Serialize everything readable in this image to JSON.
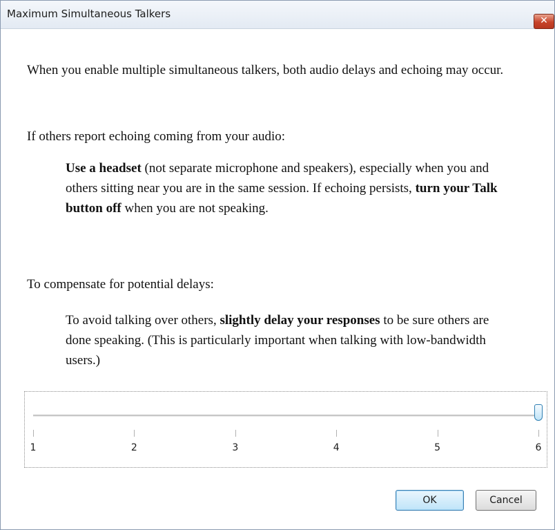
{
  "window": {
    "title": "Maximum Simultaneous Talkers",
    "close_glyph": "✕"
  },
  "body": {
    "intro": "When you enable multiple simultaneous talkers, both audio delays and echoing may occur.",
    "echo_heading": "If others report echoing coming from your audio:",
    "echo_advice": {
      "bold1": "Use a headset",
      "text1": " (not separate microphone and speakers), especially when you and others sitting near you are in the same session. If echoing persists, ",
      "bold2": "turn your Talk button off",
      "text2": " when you are not speaking."
    },
    "delay_heading": "To compensate for potential delays:",
    "delay_advice": {
      "text1": "To avoid talking over others, ",
      "bold1": "slightly delay your responses",
      "text2": " to be sure others are done speaking. (This is particularly important when talking with low-bandwidth users.)"
    }
  },
  "slider": {
    "min": 1,
    "max": 6,
    "value": 6,
    "tick_labels": [
      "1",
      "2",
      "3",
      "4",
      "5",
      "6"
    ]
  },
  "buttons": {
    "ok_label": "OK",
    "cancel_label": "Cancel"
  }
}
